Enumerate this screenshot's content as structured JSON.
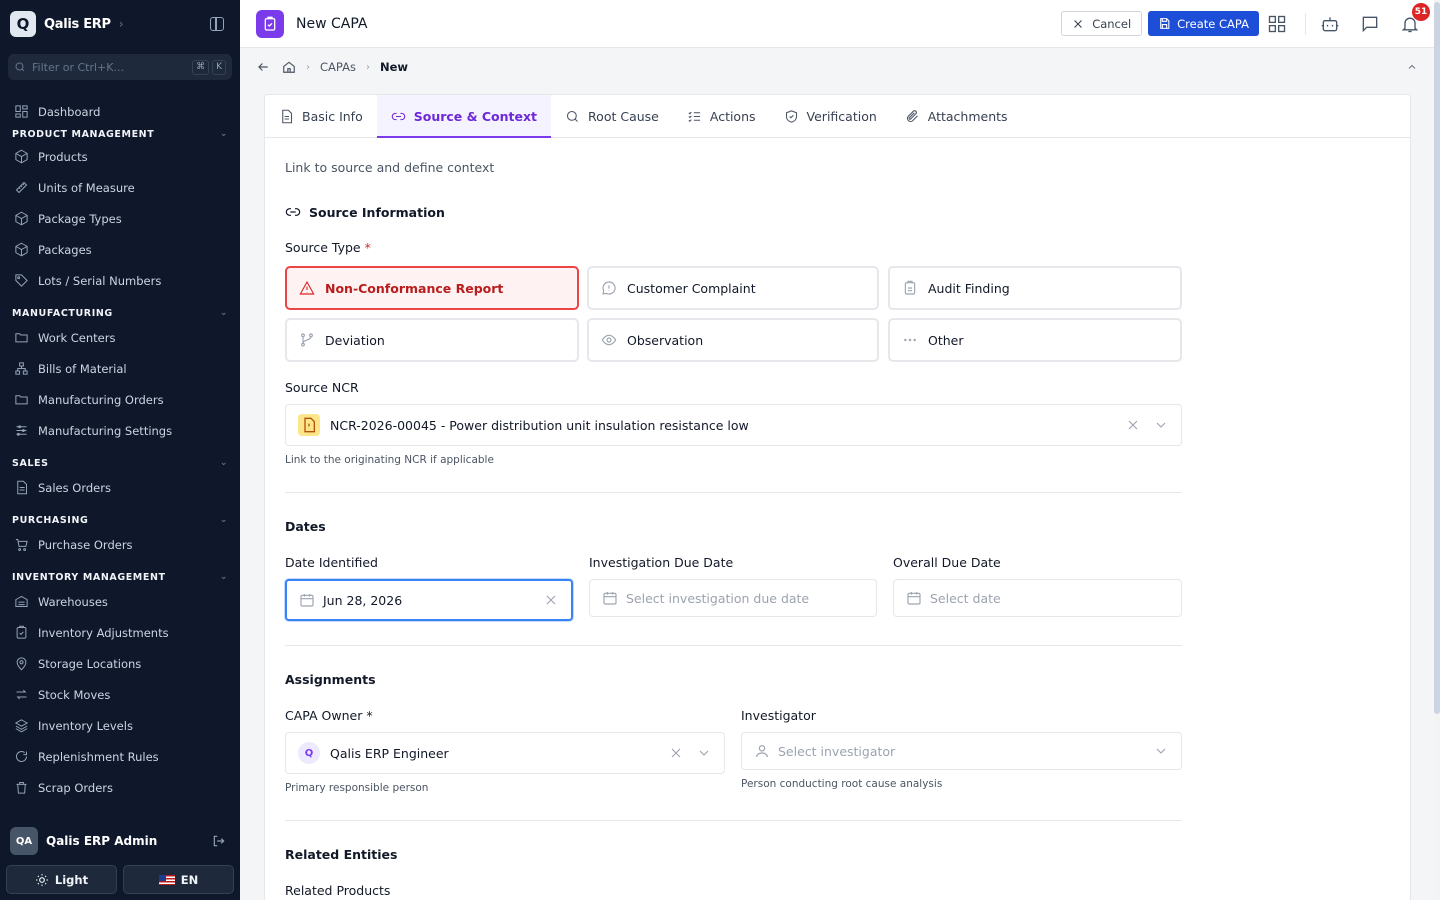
{
  "app": {
    "logo_letter": "Q",
    "name": "Qalis ERP"
  },
  "sidebar": {
    "filter_placeholder": "Filter or Ctrl+K...",
    "kbd": [
      "⌘",
      "K"
    ],
    "dashboard": "Dashboard",
    "sections": [
      {
        "title": "PRODUCT MANAGEMENT",
        "items": [
          "Products",
          "Units of Measure",
          "Package Types",
          "Packages",
          "Lots / Serial Numbers"
        ]
      },
      {
        "title": "MANUFACTURING",
        "items": [
          "Work Centers",
          "Bills of Material",
          "Manufacturing Orders",
          "Manufacturing Settings"
        ]
      },
      {
        "title": "SALES",
        "items": [
          "Sales Orders"
        ]
      },
      {
        "title": "PURCHASING",
        "items": [
          "Purchase Orders"
        ]
      },
      {
        "title": "INVENTORY MANAGEMENT",
        "items": [
          "Warehouses",
          "Inventory Adjustments",
          "Storage Locations",
          "Stock Moves",
          "Inventory Levels",
          "Replenishment Rules",
          "Scrap Orders"
        ]
      }
    ],
    "user": {
      "initials": "QA",
      "name": "Qalis ERP Admin"
    },
    "theme_label": "Light",
    "lang_label": "EN"
  },
  "topbar": {
    "title": "New CAPA",
    "cancel_label": "Cancel",
    "create_label": "Create CAPA",
    "notification_count": "51"
  },
  "breadcrumb": {
    "items": [
      "CAPAs"
    ],
    "current": "New"
  },
  "tabs": [
    {
      "label": "Basic Info",
      "icon": "file-icon"
    },
    {
      "label": "Source & Context",
      "icon": "link-icon",
      "active": true
    },
    {
      "label": "Root Cause",
      "icon": "search-icon"
    },
    {
      "label": "Actions",
      "icon": "list-check-icon"
    },
    {
      "label": "Verification",
      "icon": "shield-check-icon"
    },
    {
      "label": "Attachments",
      "icon": "paperclip-icon"
    }
  ],
  "form": {
    "intro": "Link to source and define context",
    "source_section_title": "Source Information",
    "source_type_label": "Source Type",
    "required_mark": "*",
    "source_types": [
      {
        "label": "Non-Conformance Report",
        "selected": true
      },
      {
        "label": "Customer Complaint"
      },
      {
        "label": "Audit Finding"
      },
      {
        "label": "Deviation"
      },
      {
        "label": "Observation"
      },
      {
        "label": "Other"
      }
    ],
    "source_ncr_label": "Source NCR",
    "source_ncr_value": "NCR-2026-00045 - Power distribution unit insulation resistance low",
    "source_ncr_help": "Link to the originating NCR if applicable",
    "dates_title": "Dates",
    "date_identified_label": "Date Identified",
    "date_identified_value": "Jun 28, 2026",
    "investigation_due_label": "Investigation Due Date",
    "investigation_due_placeholder": "Select investigation due date",
    "overall_due_label": "Overall Due Date",
    "overall_due_placeholder": "Select date",
    "assignments_title": "Assignments",
    "owner_label": "CAPA Owner *",
    "owner_avatar": "Q",
    "owner_value": "Qalis ERP Engineer",
    "owner_help": "Primary responsible person",
    "investigator_label": "Investigator",
    "investigator_placeholder": "Select investigator",
    "investigator_help": "Person conducting root cause analysis",
    "related_title": "Related Entities",
    "related_products_label": "Related Products"
  },
  "colors": {
    "sidebar_bg": "#0f172a",
    "accent": "#7c3aed",
    "primary": "#1d4ed8",
    "danger": "#dc2626"
  }
}
